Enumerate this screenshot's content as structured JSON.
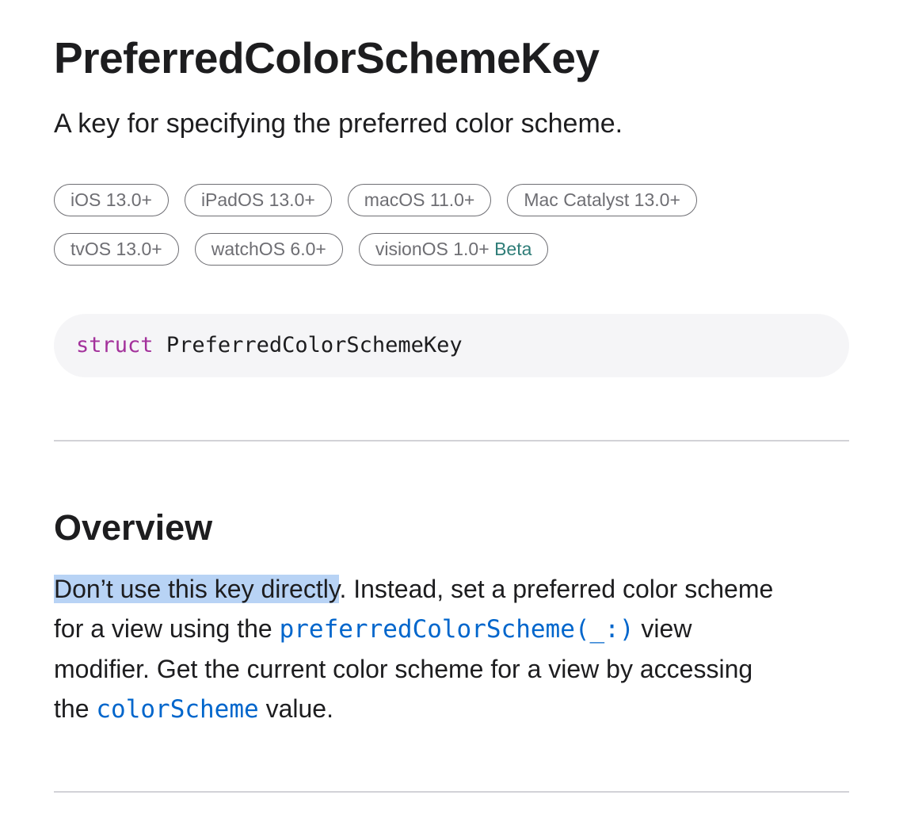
{
  "page": {
    "title": "PreferredColorSchemeKey",
    "abstract": "A key for specifying the preferred color scheme."
  },
  "availability": {
    "row1": [
      {
        "platform": "iOS 13.0+"
      },
      {
        "platform": "iPadOS 13.0+"
      },
      {
        "platform": "macOS 11.0+"
      },
      {
        "platform": "Mac Catalyst 13.0+"
      }
    ],
    "row2": [
      {
        "platform": "tvOS 13.0+"
      },
      {
        "platform": "watchOS 6.0+"
      },
      {
        "platform": "visionOS 1.0+",
        "tag": "Beta"
      }
    ]
  },
  "declaration": {
    "keyword": "struct",
    "name": "PreferredColorSchemeKey"
  },
  "overview": {
    "heading": "Overview",
    "selected_text": "Don’t use this key directly",
    "line1_rest": ". Instead, set a preferred color scheme",
    "line2_before": "for a view using the ",
    "line2_link": "preferredColorScheme(_:)",
    "line2_after": " view",
    "line3": "modifier. Get the current color scheme for a view by accessing",
    "line4_before": "the ",
    "line4_link": "colorScheme",
    "line4_after": " value."
  },
  "colors": {
    "keyword": "#a3319b",
    "link": "#0066cc",
    "beta": "#2f7d78",
    "selection": "#b8d3f5",
    "declaration_bg": "#f5f5f7"
  }
}
